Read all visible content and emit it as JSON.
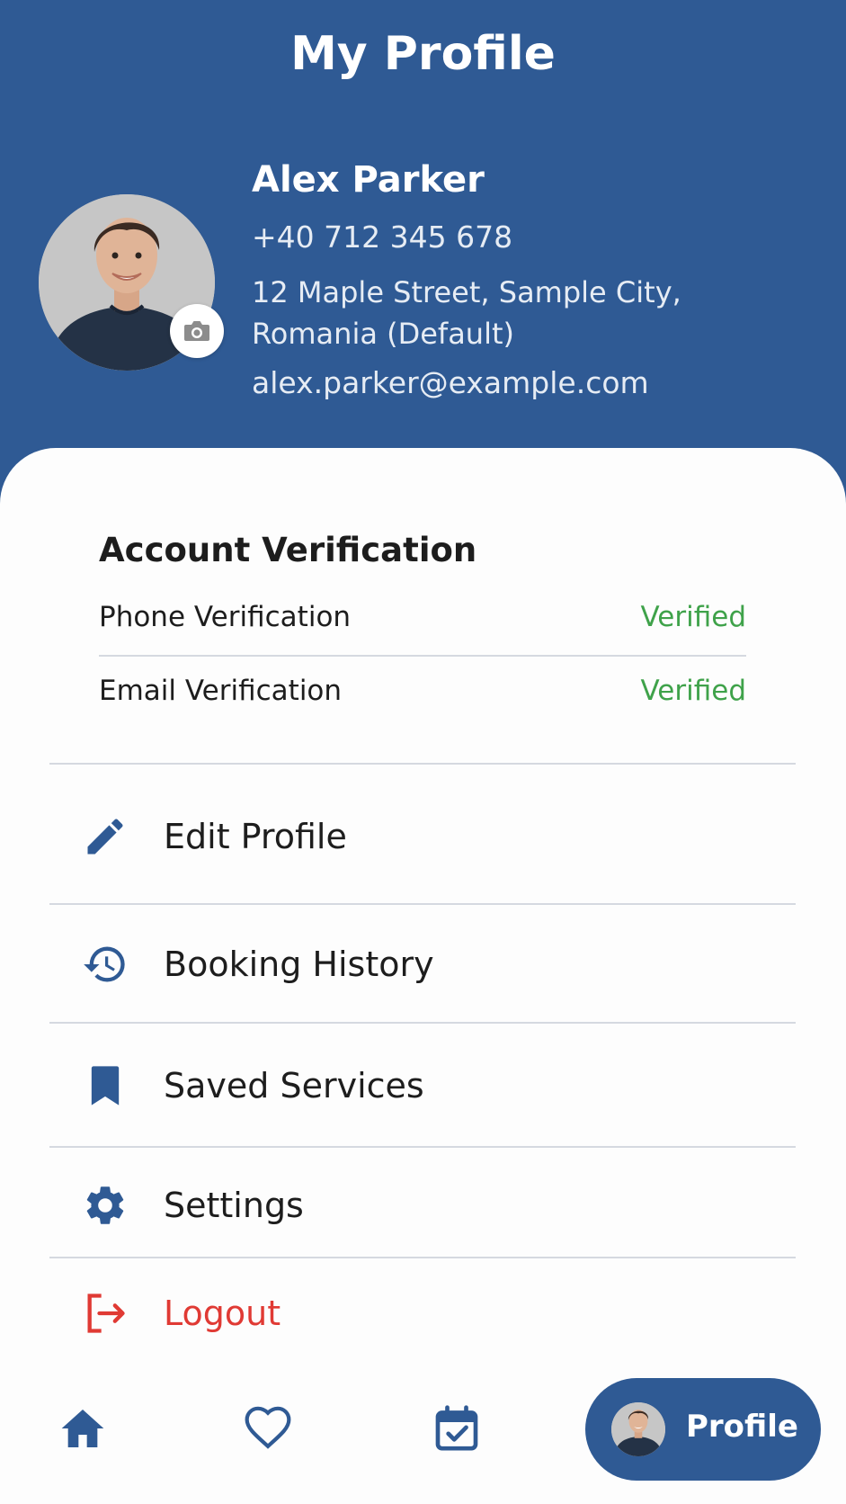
{
  "header": {
    "title": "My Profile",
    "background_color": "#2f5a94"
  },
  "profile": {
    "name": "Alex Parker",
    "phone": "+40 712 345 678",
    "address": "12 Maple Street, Sample City, Romania (Default)",
    "email": "alex.parker@example.com",
    "avatar_icon": "user-photo",
    "camera_icon": "camera-icon"
  },
  "verification": {
    "title": "Account Verification",
    "items": [
      {
        "label": "Phone Verification",
        "status": "Verified"
      },
      {
        "label": "Email Verification",
        "status": "Verified"
      }
    ],
    "status_color": "#3fa24a"
  },
  "menu": {
    "items": [
      {
        "label": "Edit Profile",
        "icon": "pencil-icon"
      },
      {
        "label": "Booking History",
        "icon": "history-icon"
      },
      {
        "label": "Saved Services",
        "icon": "bookmark-icon"
      },
      {
        "label": "Settings",
        "icon": "gear-icon"
      },
      {
        "label": "Logout",
        "icon": "logout-icon"
      }
    ],
    "logout_color": "#e03a34"
  },
  "bottom_nav": {
    "items": [
      {
        "icon": "home-icon"
      },
      {
        "icon": "heart-icon"
      },
      {
        "icon": "calendar-check-icon"
      }
    ],
    "active_label": "Profile"
  }
}
